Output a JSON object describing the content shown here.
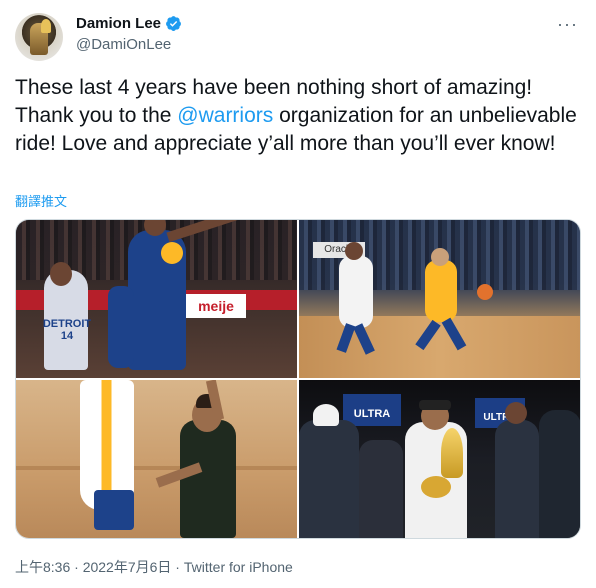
{
  "user": {
    "display_name": "Damion Lee",
    "handle": "@DamiOnLee",
    "verified": true,
    "avatar_icon": "avatar"
  },
  "more_icon": "more-options-icon",
  "tweet": {
    "text_before": "These last 4 years have been nothing short of amazing! Thank you to the ",
    "mention": "@warriors",
    "text_after": " organization for an unbelievable ride! Love and appreciate y’all more than you’ll ever know!",
    "translate_label": "翻譯推文"
  },
  "media": {
    "photo_1_text": "DETROIT 14",
    "photo_1_banner": "meije",
    "photo_2_text": "Oracle",
    "photo_4_banner_1": "ULTRA",
    "photo_4_banner_2": "ULTRA"
  },
  "footer": {
    "time": "上午8:36",
    "date": "2022年7月6日",
    "separator": " · ",
    "app": "Twitter for iPhone"
  },
  "colors": {
    "link": "#1d9bf0",
    "text": "#0f1419",
    "secondary": "#536471"
  }
}
